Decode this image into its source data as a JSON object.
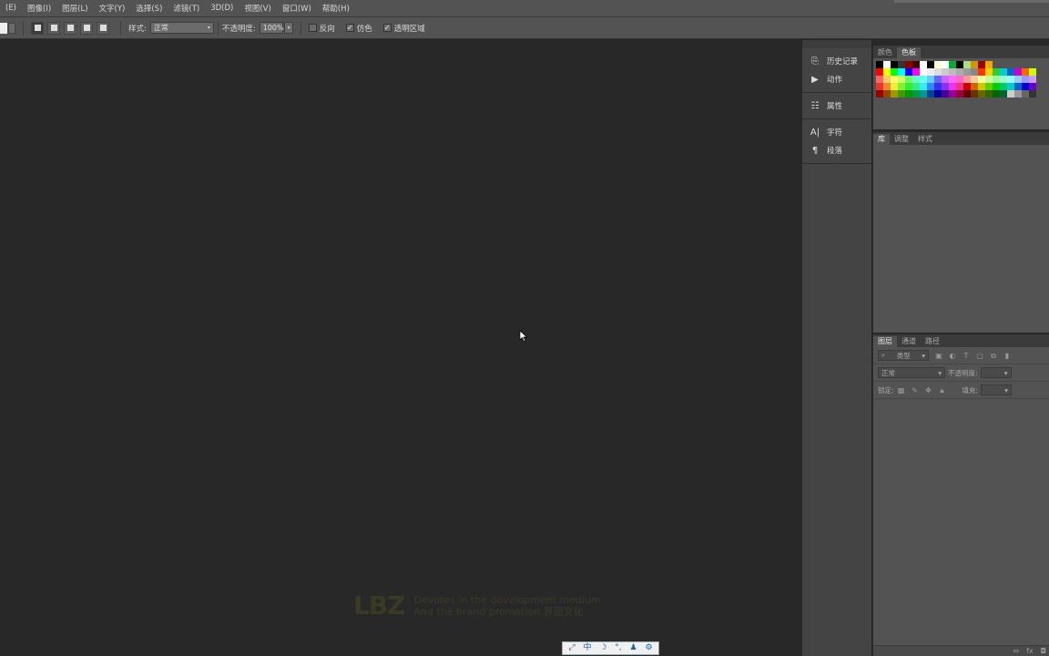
{
  "menu": [
    "(E)",
    "图像(I)",
    "图层(L)",
    "文字(Y)",
    "选择(S)",
    "滤镜(T)",
    "3D(D)",
    "视图(V)",
    "窗口(W)",
    "帮助(H)"
  ],
  "options": {
    "style_label": "样式:",
    "style_value": "正常",
    "opacity_label": "不透明度:",
    "opacity_value": "100%",
    "reverse_label": "反向",
    "dither_label": "仿色",
    "transparency_label": "透明区域",
    "reverse_checked": false,
    "dither_checked": true,
    "transparency_checked": true
  },
  "dock": {
    "items": [
      {
        "icon": "history-icon",
        "label": "历史记录"
      },
      {
        "icon": "play-icon",
        "label": "动作"
      },
      {
        "icon": "properties-icon",
        "label": "属性"
      },
      {
        "icon": "character-icon",
        "label": "字符"
      },
      {
        "icon": "paragraph-icon",
        "label": "段落"
      }
    ]
  },
  "swatch_panel": {
    "tabs": [
      "颜色",
      "色板"
    ],
    "active_tab": 1
  },
  "library_panel": {
    "tabs": [
      "库",
      "调整",
      "样式"
    ],
    "active_tab": 0
  },
  "layers_panel": {
    "tabs": [
      "图层",
      "通道",
      "路径"
    ],
    "active_tab": 0,
    "filter_label": "类型",
    "blend_mode": "正常",
    "opacity_label": "不透明度:",
    "lock_label": "锁定:",
    "fill_label": "填充:"
  },
  "watermark": {
    "logo": "LBZ",
    "line1": "Devotes in the development medium",
    "line2": "And the brand promotion 界面文化"
  },
  "ime": [
    "⤢",
    "中",
    "☽",
    "°,",
    "♟",
    "⚙"
  ]
}
